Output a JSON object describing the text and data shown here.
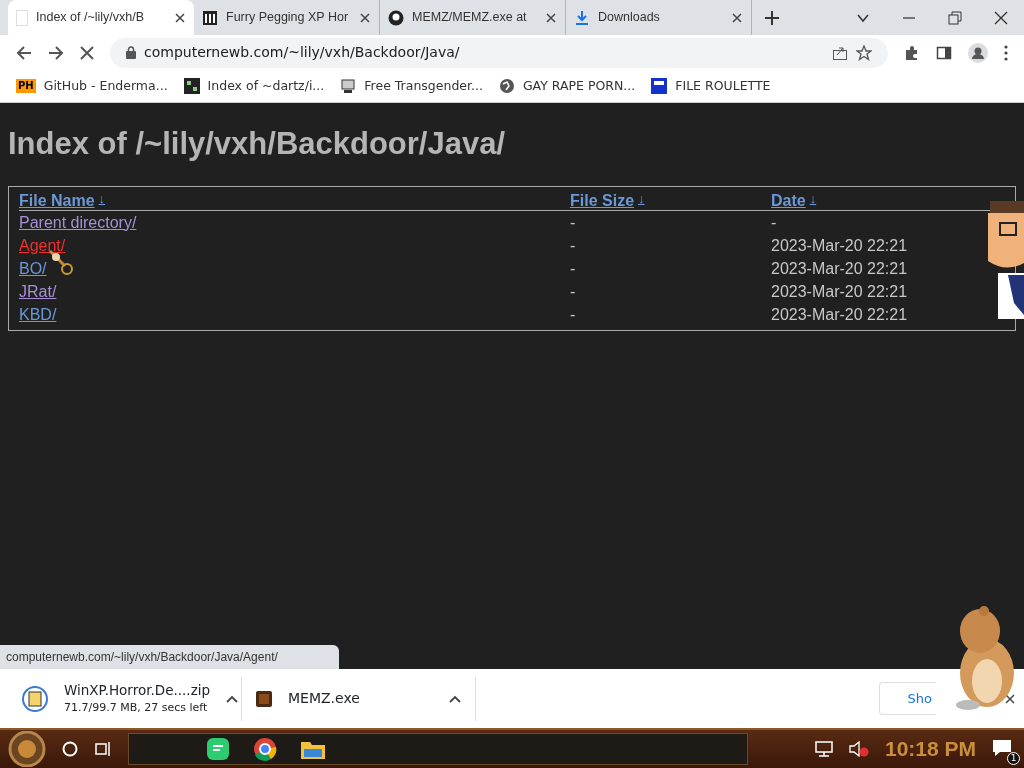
{
  "tabs": [
    {
      "title": "Index of /~lily/vxh/B",
      "selected": true,
      "kind": "blank"
    },
    {
      "title": "Furry Pegging XP Hor",
      "selected": false,
      "kind": "building"
    },
    {
      "title": "MEMZ/MEMZ.exe at",
      "selected": false,
      "kind": "github"
    },
    {
      "title": "Downloads",
      "selected": false,
      "kind": "download"
    }
  ],
  "address": "computernewb.com/~lily/vxh/Backdoor/Java/",
  "bookmarks": [
    {
      "title": "GitHub - Enderma...",
      "kind": "badge",
      "badge": "PH"
    },
    {
      "title": "Index of ~dartz/i...",
      "kind": "grid"
    },
    {
      "title": "Free Transgender...",
      "kind": "computer"
    },
    {
      "title": "GAY RAPE PORN...",
      "kind": "globe"
    },
    {
      "title": "FILE ROULETTE",
      "kind": "flag"
    }
  ],
  "page": {
    "title": "Index of /~lily/vxh/Backdoor/Java/",
    "columns": [
      {
        "label": "File Name",
        "sort": "↓"
      },
      {
        "label": "File Size",
        "sort": "↓"
      },
      {
        "label": "Date",
        "sort": "↓"
      }
    ],
    "rows": [
      {
        "name": "Parent directory/",
        "size": "-",
        "date": "-",
        "visited": true,
        "hovered": false
      },
      {
        "name": "Agent/",
        "size": "-",
        "date": "2023-Mar-20 22:21",
        "visited": false,
        "hovered": true
      },
      {
        "name": "BO/",
        "size": "-",
        "date": "2023-Mar-20 22:21",
        "visited": false,
        "hovered": false
      },
      {
        "name": "JRat/",
        "size": "-",
        "date": "2023-Mar-20 22:21",
        "visited": true,
        "hovered": false
      },
      {
        "name": "KBD/",
        "size": "-",
        "date": "2023-Mar-20 22:21",
        "visited": false,
        "hovered": false
      }
    ]
  },
  "status_url": "computernewb.com/~lily/vxh/Backdoor/Java/Agent/",
  "downloads": [
    {
      "name": "WinXP.Horror.De....zip",
      "detail": "71.7/99.7 MB, 27 secs left",
      "kind": "zip"
    },
    {
      "name": "MEMZ.exe",
      "kind": "exe"
    }
  ],
  "show_all": "Sho",
  "taskbar": {
    "time": "10:18 PM",
    "notifications": "1"
  }
}
